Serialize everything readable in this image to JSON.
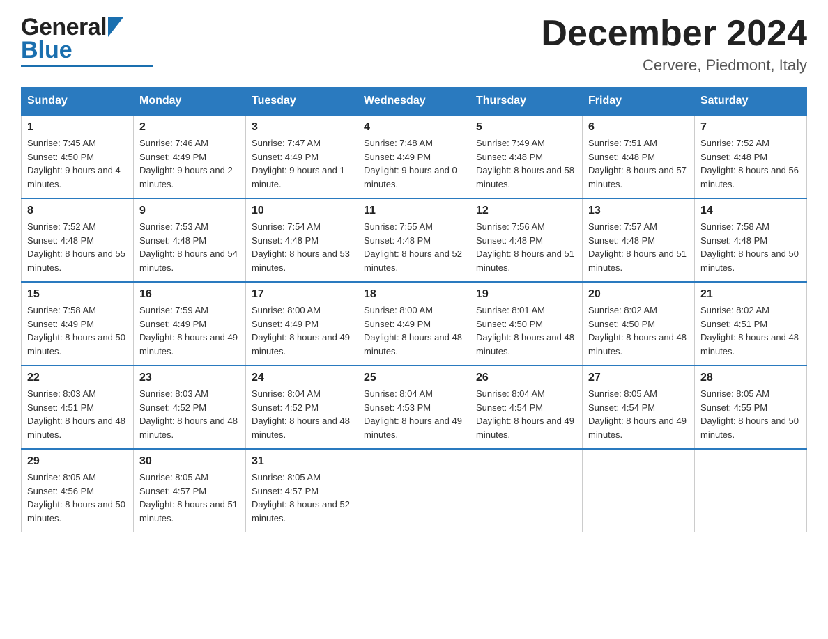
{
  "header": {
    "logo_general": "General",
    "logo_blue": "Blue",
    "title": "December 2024",
    "subtitle": "Cervere, Piedmont, Italy"
  },
  "calendar": {
    "weekdays": [
      "Sunday",
      "Monday",
      "Tuesday",
      "Wednesday",
      "Thursday",
      "Friday",
      "Saturday"
    ],
    "weeks": [
      [
        {
          "day": "1",
          "sunrise": "7:45 AM",
          "sunset": "4:50 PM",
          "daylight": "9 hours and 4 minutes."
        },
        {
          "day": "2",
          "sunrise": "7:46 AM",
          "sunset": "4:49 PM",
          "daylight": "9 hours and 2 minutes."
        },
        {
          "day": "3",
          "sunrise": "7:47 AM",
          "sunset": "4:49 PM",
          "daylight": "9 hours and 1 minute."
        },
        {
          "day": "4",
          "sunrise": "7:48 AM",
          "sunset": "4:49 PM",
          "daylight": "9 hours and 0 minutes."
        },
        {
          "day": "5",
          "sunrise": "7:49 AM",
          "sunset": "4:48 PM",
          "daylight": "8 hours and 58 minutes."
        },
        {
          "day": "6",
          "sunrise": "7:51 AM",
          "sunset": "4:48 PM",
          "daylight": "8 hours and 57 minutes."
        },
        {
          "day": "7",
          "sunrise": "7:52 AM",
          "sunset": "4:48 PM",
          "daylight": "8 hours and 56 minutes."
        }
      ],
      [
        {
          "day": "8",
          "sunrise": "7:52 AM",
          "sunset": "4:48 PM",
          "daylight": "8 hours and 55 minutes."
        },
        {
          "day": "9",
          "sunrise": "7:53 AM",
          "sunset": "4:48 PM",
          "daylight": "8 hours and 54 minutes."
        },
        {
          "day": "10",
          "sunrise": "7:54 AM",
          "sunset": "4:48 PM",
          "daylight": "8 hours and 53 minutes."
        },
        {
          "day": "11",
          "sunrise": "7:55 AM",
          "sunset": "4:48 PM",
          "daylight": "8 hours and 52 minutes."
        },
        {
          "day": "12",
          "sunrise": "7:56 AM",
          "sunset": "4:48 PM",
          "daylight": "8 hours and 51 minutes."
        },
        {
          "day": "13",
          "sunrise": "7:57 AM",
          "sunset": "4:48 PM",
          "daylight": "8 hours and 51 minutes."
        },
        {
          "day": "14",
          "sunrise": "7:58 AM",
          "sunset": "4:48 PM",
          "daylight": "8 hours and 50 minutes."
        }
      ],
      [
        {
          "day": "15",
          "sunrise": "7:58 AM",
          "sunset": "4:49 PM",
          "daylight": "8 hours and 50 minutes."
        },
        {
          "day": "16",
          "sunrise": "7:59 AM",
          "sunset": "4:49 PM",
          "daylight": "8 hours and 49 minutes."
        },
        {
          "day": "17",
          "sunrise": "8:00 AM",
          "sunset": "4:49 PM",
          "daylight": "8 hours and 49 minutes."
        },
        {
          "day": "18",
          "sunrise": "8:00 AM",
          "sunset": "4:49 PM",
          "daylight": "8 hours and 48 minutes."
        },
        {
          "day": "19",
          "sunrise": "8:01 AM",
          "sunset": "4:50 PM",
          "daylight": "8 hours and 48 minutes."
        },
        {
          "day": "20",
          "sunrise": "8:02 AM",
          "sunset": "4:50 PM",
          "daylight": "8 hours and 48 minutes."
        },
        {
          "day": "21",
          "sunrise": "8:02 AM",
          "sunset": "4:51 PM",
          "daylight": "8 hours and 48 minutes."
        }
      ],
      [
        {
          "day": "22",
          "sunrise": "8:03 AM",
          "sunset": "4:51 PM",
          "daylight": "8 hours and 48 minutes."
        },
        {
          "day": "23",
          "sunrise": "8:03 AM",
          "sunset": "4:52 PM",
          "daylight": "8 hours and 48 minutes."
        },
        {
          "day": "24",
          "sunrise": "8:04 AM",
          "sunset": "4:52 PM",
          "daylight": "8 hours and 48 minutes."
        },
        {
          "day": "25",
          "sunrise": "8:04 AM",
          "sunset": "4:53 PM",
          "daylight": "8 hours and 49 minutes."
        },
        {
          "day": "26",
          "sunrise": "8:04 AM",
          "sunset": "4:54 PM",
          "daylight": "8 hours and 49 minutes."
        },
        {
          "day": "27",
          "sunrise": "8:05 AM",
          "sunset": "4:54 PM",
          "daylight": "8 hours and 49 minutes."
        },
        {
          "day": "28",
          "sunrise": "8:05 AM",
          "sunset": "4:55 PM",
          "daylight": "8 hours and 50 minutes."
        }
      ],
      [
        {
          "day": "29",
          "sunrise": "8:05 AM",
          "sunset": "4:56 PM",
          "daylight": "8 hours and 50 minutes."
        },
        {
          "day": "30",
          "sunrise": "8:05 AM",
          "sunset": "4:57 PM",
          "daylight": "8 hours and 51 minutes."
        },
        {
          "day": "31",
          "sunrise": "8:05 AM",
          "sunset": "4:57 PM",
          "daylight": "8 hours and 52 minutes."
        },
        null,
        null,
        null,
        null
      ]
    ],
    "sunrise_label": "Sunrise:",
    "sunset_label": "Sunset:",
    "daylight_label": "Daylight:"
  }
}
